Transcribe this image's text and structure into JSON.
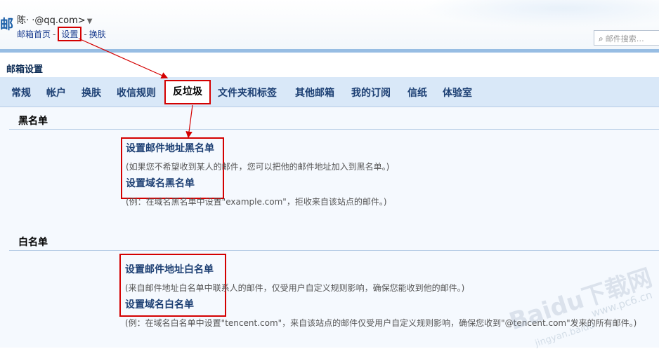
{
  "header": {
    "logo_fragment": "邮",
    "account": "陈·           ·@qq.com>",
    "account_caret": "▼",
    "links": [
      "邮箱首页",
      "设置",
      "换肤"
    ],
    "separator": "-",
    "search_placeholder": "邮件搜索…"
  },
  "page_title": "邮箱设置",
  "tabs": [
    "常规",
    "帐户",
    "换肤",
    "收信规则",
    "反垃圾",
    "文件夹和标签",
    "其他邮箱",
    "我的订阅",
    "信纸",
    "体验室"
  ],
  "active_tab": "反垃圾",
  "blacklist": {
    "title": "黑名单",
    "address_link": "设置邮件地址黑名单",
    "address_hint": "(如果您不希望收到某人的邮件，您可以把他的邮件地址加入到黑名单。)",
    "domain_link": "设置域名黑名单",
    "domain_hint": "(例：在域名黑名单中设置\"example.com\"，拒收来自该站点的邮件。)"
  },
  "whitelist": {
    "title": "白名单",
    "address_link": "设置邮件地址白名单",
    "address_hint": "(来自邮件地址白名单中联系人的邮件，仅受用户自定义规则影响，确保您能收到他的邮件。)",
    "domain_link": "设置域名白名单",
    "domain_hint": "(例：在域名白名单中设置\"tencent.com\"，来自该站点的邮件仅受用户自定义规则影响，确保您收到\"@tencent.com\"发来的所有邮件。)"
  },
  "watermark": {
    "text": "Baidu下载网",
    "url": "www.pc6.cn",
    "sub": "jingyan.baidu"
  },
  "colors": {
    "highlight": "#d40000",
    "tab_bg": "#d9e8f8",
    "link": "#1c3f73"
  }
}
